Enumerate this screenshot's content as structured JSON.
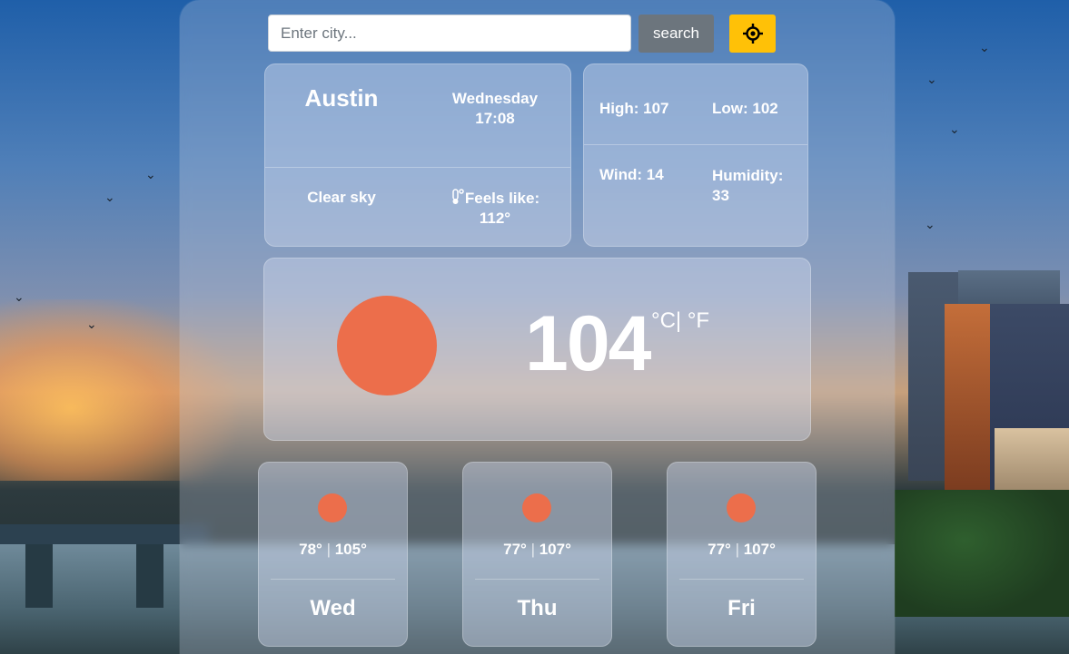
{
  "search": {
    "placeholder": "Enter city...",
    "button_label": "search"
  },
  "location": {
    "city": "Austin",
    "day": "Wednesday",
    "time": "17:08",
    "condition": "Clear sky",
    "feels_like_label": "Feels like:",
    "feels_like_value": "112°"
  },
  "stats": {
    "high": "High: 107",
    "low": "Low: 102",
    "wind": "Wind: 14",
    "humidity_label": "Humidity:",
    "humidity_value": "33"
  },
  "current": {
    "temperature": "104",
    "unit_toggle": "°C| °F"
  },
  "forecast": [
    {
      "low": "78°",
      "separator": "|",
      "high": "105°",
      "day": "Wed"
    },
    {
      "low": "77°",
      "separator": "|",
      "high": "107°",
      "day": "Thu"
    },
    {
      "low": "77°",
      "separator": "|",
      "high": "107°",
      "day": "Fri"
    }
  ],
  "colors": {
    "sun": "#ec6e4b",
    "search_button": "#6c757d",
    "locate_button": "#ffc107"
  },
  "icons": {
    "locate": "crosshair-icon",
    "thermometer": "thermometer-icon",
    "weather": "sun-icon"
  }
}
